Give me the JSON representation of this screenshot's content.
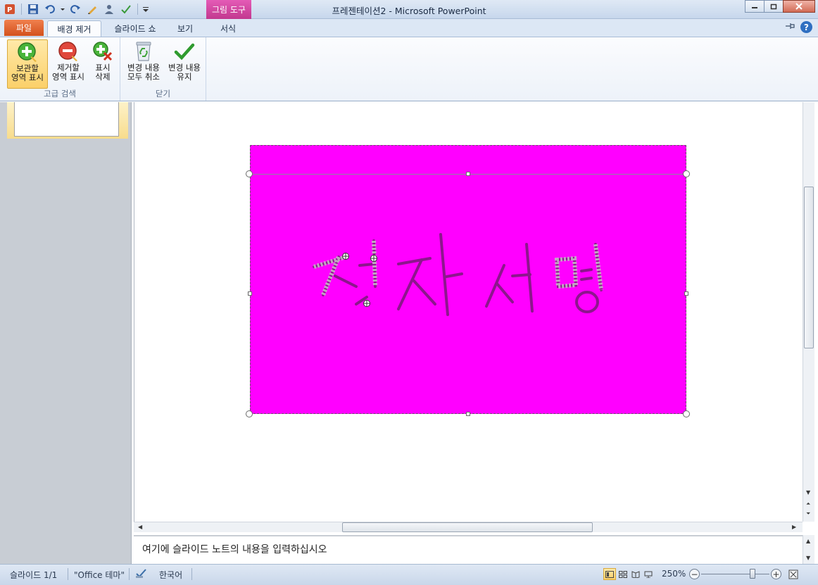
{
  "window": {
    "title": "프레젠테이션2 - Microsoft PowerPoint",
    "context_tab": "그림 도구"
  },
  "tabs": {
    "file": "파일",
    "items": [
      "배경 제거",
      "슬라이드 쇼",
      "보기",
      "서식"
    ],
    "active_index": 0
  },
  "ribbon": {
    "group1": {
      "label": "고급 검색",
      "buttons": [
        {
          "line1": "보관할",
          "line2": "영역 표시",
          "icon": "plus-green-icon",
          "selected": true
        },
        {
          "line1": "제거할",
          "line2": "영역 표시",
          "icon": "minus-red-icon"
        },
        {
          "line1": "표시",
          "line2": "삭제",
          "icon": "delete-mark-icon"
        }
      ]
    },
    "group2": {
      "label": "닫기",
      "buttons": [
        {
          "line1": "변경 내용",
          "line2": "모두 취소",
          "icon": "recycle-bin-icon"
        },
        {
          "line1": "변경 내용",
          "line2": "유지",
          "icon": "checkmark-icon"
        }
      ]
    }
  },
  "slide": {
    "picture_text": "전자서명",
    "picture_background": "#ff00ff",
    "ink_color": "#7a1a7a"
  },
  "notes": {
    "placeholder": "여기에 슬라이드 노트의 내용을 입력하십시오"
  },
  "status": {
    "slide": "슬라이드 1/1",
    "theme": "\"Office 테마\"",
    "language": "한국어",
    "zoom": "250%"
  },
  "colors": {
    "file_tab": "#d3511c",
    "context_tab": "#c2388f",
    "accent": "#2f6fc1"
  }
}
